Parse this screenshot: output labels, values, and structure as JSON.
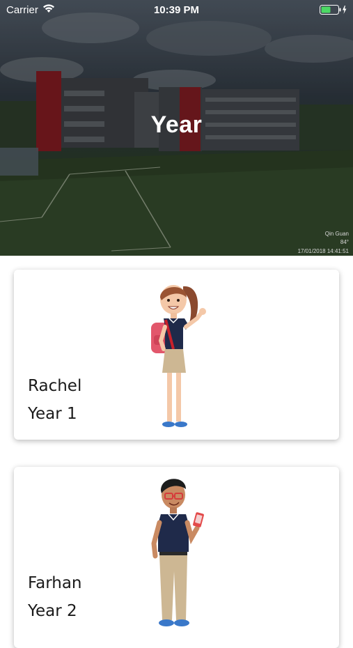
{
  "status_bar": {
    "carrier": "Carrier",
    "time": "10:39 PM"
  },
  "header": {
    "title": "Year",
    "watermark": {
      "name": "Qin Guan",
      "temp": "84°",
      "timestamp": "17/01/2018 14:41:51"
    }
  },
  "students": [
    {
      "name": "Rachel",
      "year": "Year 1",
      "avatar_icon": "girl-student-illustration"
    },
    {
      "name": "Farhan",
      "year": "Year 2",
      "avatar_icon": "boy-student-illustration"
    }
  ],
  "colors": {
    "accent_red": "#c8212b",
    "shirt_navy": "#1f2a4a",
    "card_bg": "#ffffff"
  }
}
